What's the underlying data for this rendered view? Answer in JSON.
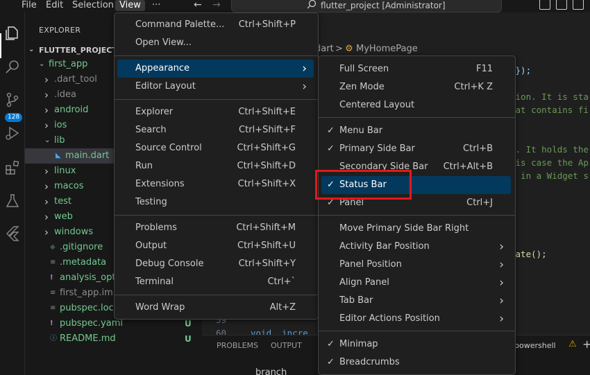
{
  "menubar": {
    "file": "File",
    "edit": "Edit",
    "selection": "Selection",
    "view": "View",
    "more": "···"
  },
  "title_search": "flutter_project [Administrator]",
  "explorer": {
    "title": "EXPLORER",
    "project": "FLUTTER_PROJECT",
    "scm_badge": "128",
    "items": [
      {
        "label": "first_app",
        "color": "#73c991",
        "chevron": "down"
      },
      {
        "label": ".dart_tool",
        "color": "#8c8c8c",
        "chevron": "right"
      },
      {
        "label": ".idea",
        "color": "#8c8c8c",
        "chevron": "right"
      },
      {
        "label": "android",
        "color": "#73c991",
        "chevron": "right"
      },
      {
        "label": "ios",
        "color": "#73c991",
        "chevron": "right"
      },
      {
        "label": "lib",
        "color": "#73c991",
        "chevron": "down"
      },
      {
        "label": "main.dart",
        "color": "#73c991",
        "chevron": ""
      },
      {
        "label": "linux",
        "color": "#73c991",
        "chevron": "right"
      },
      {
        "label": "macos",
        "color": "#73c991",
        "chevron": "right"
      },
      {
        "label": "test",
        "color": "#73c991",
        "chevron": "right"
      },
      {
        "label": "web",
        "color": "#73c991",
        "chevron": "right"
      },
      {
        "label": "windows",
        "color": "#73c991",
        "chevron": "right"
      },
      {
        "label": ".gitignore",
        "color": "#73c991",
        "chevron": ""
      },
      {
        "label": ".metadata",
        "color": "#73c991",
        "chevron": ""
      },
      {
        "label": "analysis_option",
        "color": "#73c991",
        "chevron": ""
      },
      {
        "label": "first_app.iml",
        "color": "#8c8c8c",
        "chevron": ""
      },
      {
        "label": "pubspec.lock",
        "color": "#73c991",
        "chevron": "",
        "status": "U"
      },
      {
        "label": "pubspec.yaml",
        "color": "#73c991",
        "chevron": "",
        "status": "U"
      },
      {
        "label": "README.md",
        "color": "#73c991",
        "chevron": "",
        "status": "U"
      }
    ]
  },
  "editor": {
    "breadcrumb_file": "dart",
    "breadcrumb_class": "MyHomePage",
    "code": [
      "e});",
      "tion. It is sta",
      "hat contains fi",
      "e. It holds the",
      "his case the Ap",
      "s in a Widget s",
      "tate();"
    ],
    "line_numbers": [
      "59",
      "60"
    ],
    "bottom_code": "void  incre"
  },
  "panel": {
    "problems": "PROBLEMS",
    "output": "OUTPUT",
    "terminal_label": "powershell",
    "branch": "branch"
  },
  "view_menu": {
    "items": [
      {
        "label": "Command Palette...",
        "shortcut": "Ctrl+Shift+P"
      },
      {
        "label": "Open View...",
        "shortcut": ""
      },
      {
        "label": "Appearance",
        "shortcut": "",
        "submenu": true,
        "highlight": true
      },
      {
        "label": "Editor Layout",
        "shortcut": "",
        "submenu": true
      },
      {
        "label": "Explorer",
        "shortcut": "Ctrl+Shift+E"
      },
      {
        "label": "Search",
        "shortcut": "Ctrl+Shift+F"
      },
      {
        "label": "Source Control",
        "shortcut": "Ctrl+Shift+G"
      },
      {
        "label": "Run",
        "shortcut": "Ctrl+Shift+D"
      },
      {
        "label": "Extensions",
        "shortcut": "Ctrl+Shift+X"
      },
      {
        "label": "Testing",
        "shortcut": ""
      },
      {
        "label": "Problems",
        "shortcut": "Ctrl+Shift+M"
      },
      {
        "label": "Output",
        "shortcut": "Ctrl+Shift+U"
      },
      {
        "label": "Debug Console",
        "shortcut": "Ctrl+Shift+Y"
      },
      {
        "label": "Terminal",
        "shortcut": "Ctrl+`"
      },
      {
        "label": "Word Wrap",
        "shortcut": "Alt+Z"
      }
    ]
  },
  "appearance_menu": {
    "items": [
      {
        "label": "Full Screen",
        "shortcut": "F11"
      },
      {
        "label": "Zen Mode",
        "shortcut": "Ctrl+K Z"
      },
      {
        "label": "Centered Layout",
        "shortcut": ""
      },
      {
        "label": "Menu Bar",
        "shortcut": "",
        "checked": true
      },
      {
        "label": "Primary Side Bar",
        "shortcut": "Ctrl+B",
        "checked": true
      },
      {
        "label": "Secondary Side Bar",
        "shortcut": "Ctrl+Alt+B"
      },
      {
        "label": "Status Bar",
        "shortcut": "",
        "checked": true,
        "highlight": true
      },
      {
        "label": "Panel",
        "shortcut": "Ctrl+J",
        "checked": true
      },
      {
        "label": "Move Primary Side Bar Right",
        "shortcut": ""
      },
      {
        "label": "Activity Bar Position",
        "shortcut": "",
        "submenu": true
      },
      {
        "label": "Panel Position",
        "shortcut": "",
        "submenu": true
      },
      {
        "label": "Align Panel",
        "shortcut": "",
        "submenu": true
      },
      {
        "label": "Tab Bar",
        "shortcut": "",
        "submenu": true
      },
      {
        "label": "Editor Actions Position",
        "shortcut": "",
        "submenu": true
      },
      {
        "label": "Minimap",
        "shortcut": "",
        "checked": true
      },
      {
        "label": "Breadcrumbs",
        "shortcut": "",
        "checked": true
      }
    ]
  },
  "colors": {
    "accent": "#0078d4",
    "highlight": "#04395e",
    "git_added": "#73c991",
    "annotation": "#e01b1b"
  }
}
